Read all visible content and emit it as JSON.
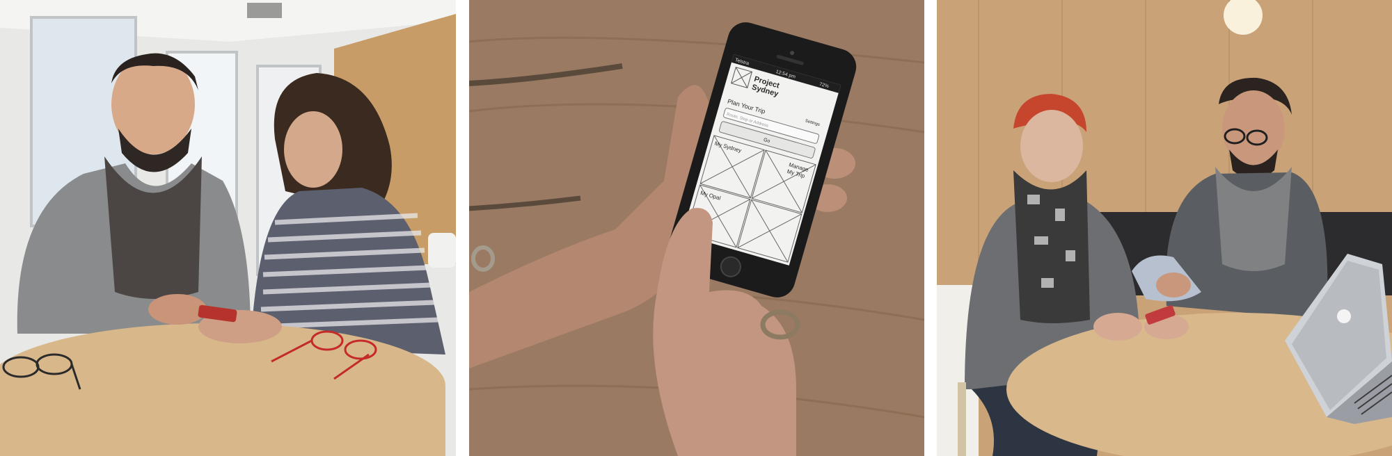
{
  "photos": [
    {
      "id": "left",
      "description_name": "man-and-woman-testing-phone"
    },
    {
      "id": "middle",
      "description_name": "hand-holding-phone-prototype"
    },
    {
      "id": "right",
      "description_name": "two-people-reviewing-phone-with-laptop"
    }
  ],
  "phone_screen": {
    "status_carrier": "Telstra",
    "status_time": "12:54 pm",
    "status_battery": "72%",
    "app_title_line1": "Project",
    "app_title_line2": "Sydney",
    "settings_label": "Settings",
    "plan_heading": "Plan Your Trip",
    "search_placeholder": "Route, Stop or Address",
    "go_label": "Go",
    "tile_1": "My Sydney",
    "tile_2_line1": "Manage",
    "tile_2_line2": "My Trip",
    "tile_3": "My Opal"
  }
}
